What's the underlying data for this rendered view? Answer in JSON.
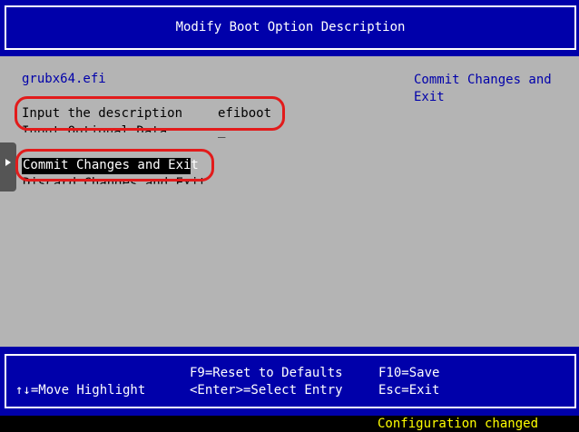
{
  "header": {
    "title": "Modify Boot Option Description"
  },
  "main": {
    "file_name": "grubx64.efi",
    "options": [
      {
        "label": "Input the description",
        "value": "efiboot"
      },
      {
        "label": "Input Optional Data",
        "value": "_"
      }
    ],
    "actions": [
      {
        "label": "Commit Changes and Exit"
      },
      {
        "label": "Discard Changes and Exit"
      }
    ],
    "help_text_line1": "Commit Changes and",
    "help_text_line2": "Exit"
  },
  "footer": {
    "move_highlight": "↑↓=Move Highlight",
    "reset_defaults": "F9=Reset to Defaults",
    "select_entry": "<Enter>=Select Entry",
    "save": "F10=Save",
    "exit": "Esc=Exit"
  },
  "status": {
    "message": "Configuration changed"
  },
  "colors": {
    "background": "#b4b4b4",
    "primary_blue": "#0000aa",
    "annotation_red": "#e21b1b",
    "status_yellow": "#ffff00"
  }
}
